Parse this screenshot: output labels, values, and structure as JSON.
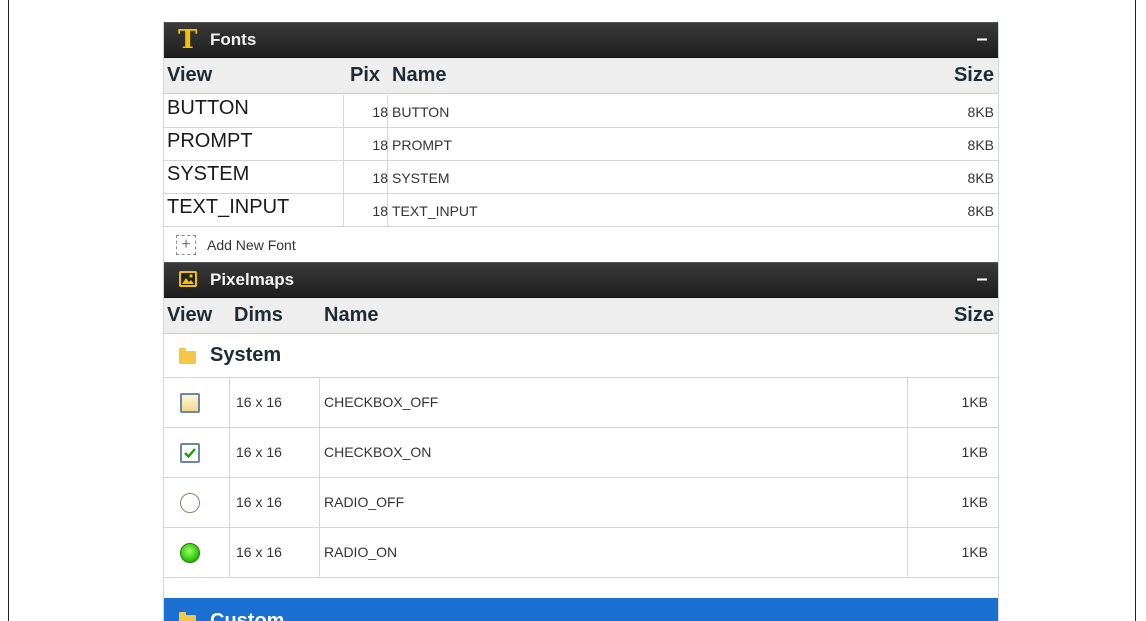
{
  "fonts": {
    "title": "Fonts",
    "collapse": "–",
    "columns": {
      "view": "View",
      "pix": "Pix",
      "name": "Name",
      "size": "Size"
    },
    "rows": [
      {
        "view": "BUTTON",
        "pix": "18",
        "name": "BUTTON",
        "size": "8KB"
      },
      {
        "view": "PROMPT",
        "pix": "18",
        "name": "PROMPT",
        "size": "8KB"
      },
      {
        "view": "SYSTEM",
        "pix": "18",
        "name": "SYSTEM",
        "size": "8KB"
      },
      {
        "view": "TEXT_INPUT",
        "pix": "18",
        "name": "TEXT_INPUT",
        "size": "8KB"
      }
    ],
    "add_label": "Add New Font"
  },
  "pixelmaps": {
    "title": "Pixelmaps",
    "collapse": "–",
    "columns": {
      "view": "View",
      "dims": "Dims",
      "name": "Name",
      "size": "Size"
    },
    "folders": [
      {
        "label": "System"
      },
      {
        "label": "Custom"
      }
    ],
    "rows": [
      {
        "icon": "checkbox-off-icon",
        "dims": "16 x 16",
        "name": "CHECKBOX_OFF",
        "size": "1KB"
      },
      {
        "icon": "checkbox-on-icon",
        "dims": "16 x 16",
        "name": "CHECKBOX_ON",
        "size": "1KB"
      },
      {
        "icon": "radio-off-icon",
        "dims": "16 x 16",
        "name": "RADIO_OFF",
        "size": "1KB"
      },
      {
        "icon": "radio-on-icon",
        "dims": "16 x 16",
        "name": "RADIO_ON",
        "size": "1KB"
      }
    ]
  },
  "colors": {
    "header_bg": "#2a2a2a",
    "selected_bg": "#1a6fd1",
    "accent": "#f2c200"
  }
}
